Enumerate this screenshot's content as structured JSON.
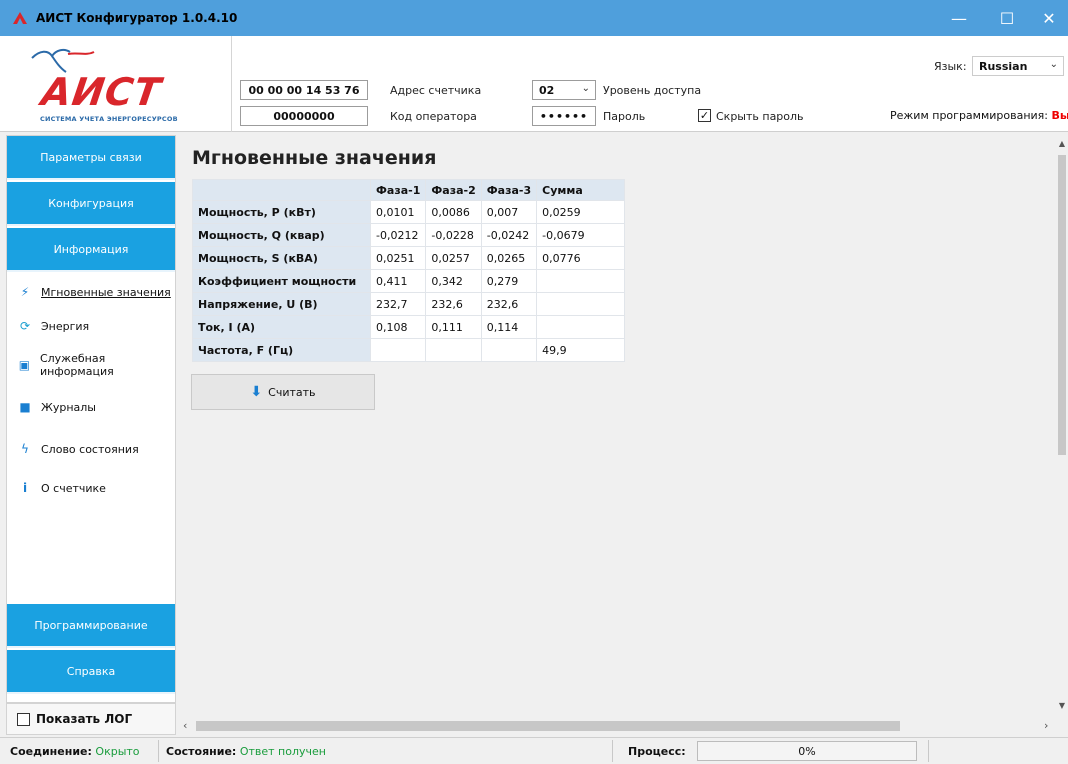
{
  "window": {
    "title": "АИСТ Конфигуратор 1.0.4.10",
    "controls": {
      "minimize": "—",
      "maximize": "☐",
      "close": "✕"
    }
  },
  "header": {
    "logo_text": "АИСТ",
    "logo_subtitle": "СИСТЕМА УЧЕТА ЭНЕРГОРЕСУРСОВ",
    "meter_address_value": "00 00 00 14 53 76",
    "meter_address_label": "Адрес счетчика",
    "operator_code_value": "00000000",
    "operator_code_label": "Код оператора",
    "access_level_value": "02",
    "access_level_label": "Уровень доступа",
    "password_value": "••••••",
    "password_label": "Пароль",
    "hide_password_label": "Скрыть пароль",
    "hide_password_checked": true,
    "language_label": "Язык:",
    "language_value": "Russian",
    "programming_mode_label": "Режим программирования:",
    "programming_mode_value": "Выкл"
  },
  "sidebar": {
    "top_buttons": [
      "Параметры связи",
      "Конфигурация",
      "Информация"
    ],
    "sub_items": [
      {
        "label": "Мгновенные значения",
        "icon": "lightning-icon",
        "active": true
      },
      {
        "label": "Энергия",
        "icon": "energy-icon",
        "active": false
      },
      {
        "label": "Служебная информация",
        "icon": "id-card-icon",
        "active": false
      },
      {
        "label": "Журналы",
        "icon": "journal-icon",
        "active": false
      },
      {
        "label": "Слово состояния",
        "icon": "status-bolt-icon",
        "active": false
      },
      {
        "label": "О счетчике",
        "icon": "info-icon",
        "active": false
      }
    ],
    "bottom_buttons": [
      "Программирование",
      "Справка"
    ],
    "show_log_label": "Показать ЛОГ",
    "show_log_checked": false
  },
  "main": {
    "title": "Мгновенные значения",
    "table": {
      "columns": [
        "",
        "Фаза-1",
        "Фаза-2",
        "Фаза-3",
        "Сумма"
      ],
      "rows": [
        [
          "Мощность, P (кВт)",
          "0,0101",
          "0,0086",
          "0,007",
          "0,0259"
        ],
        [
          "Мощность, Q (квар)",
          "-0,0212",
          "-0,0228",
          "-0,0242",
          "-0,0679"
        ],
        [
          "Мощность, S (кВА)",
          "0,0251",
          "0,0257",
          "0,0265",
          "0,0776"
        ],
        [
          "Коэффициент мощности",
          "0,411",
          "0,342",
          "0,279",
          ""
        ],
        [
          "Напряжение, U (В)",
          "232,7",
          "232,6",
          "232,6",
          ""
        ],
        [
          "Ток, I (А)",
          "0,108",
          "0,111",
          "0,114",
          ""
        ],
        [
          "Частота, F (Гц)",
          "",
          "",
          "",
          "49,9"
        ]
      ]
    },
    "read_button_label": "Считать"
  },
  "statusbar": {
    "connection_label": "Соединение:",
    "connection_value": "Окрыто",
    "state_label": "Состояние:",
    "state_value": "Ответ получен",
    "process_label": "Процесс:",
    "process_percent_text": "0%",
    "process_fraction": 0
  },
  "colors": {
    "titlebar": "#4f9fdc",
    "nav_button": "#1aa1e1",
    "logo_red": "#d9262b",
    "status_ok": "#199c3c",
    "prog_off": "#ee0000"
  }
}
